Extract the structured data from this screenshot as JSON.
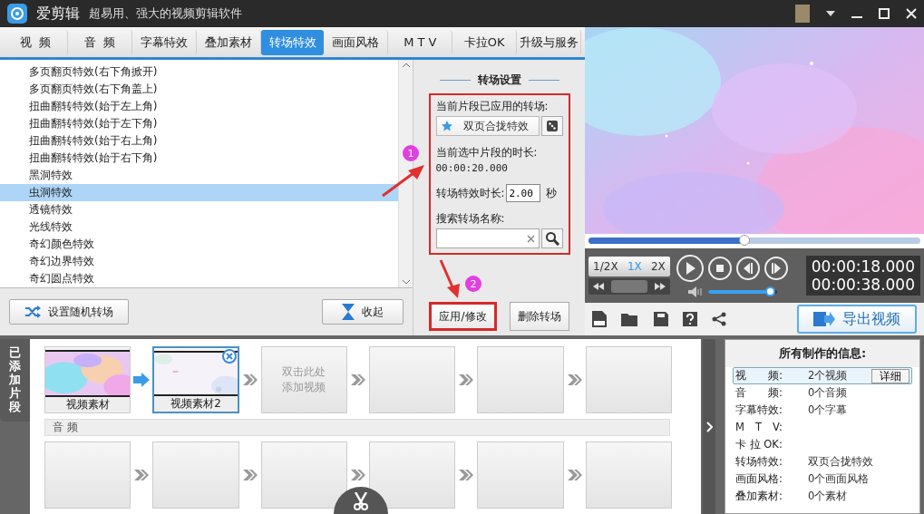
{
  "app": {
    "name": "爱剪辑",
    "slogan": "超易用、强大的视频剪辑软件"
  },
  "tabs": [
    {
      "label": "视  频",
      "selected": false
    },
    {
      "label": "音  频",
      "selected": false
    },
    {
      "label": "字幕特效",
      "selected": false
    },
    {
      "label": "叠加素材",
      "selected": false
    },
    {
      "label": "转场特效",
      "selected": true
    },
    {
      "label": "画面风格",
      "selected": false
    },
    {
      "label": "M T V",
      "selected": false
    },
    {
      "label": "卡拉OK",
      "selected": false
    },
    {
      "label": "升级与服务",
      "selected": false
    }
  ],
  "effects": [
    {
      "label": "多页翻页特效(右下角掀开)",
      "selected": false
    },
    {
      "label": "多页翻页特效(右下角盖上)",
      "selected": false
    },
    {
      "label": "扭曲翻转特效(始于左上角)",
      "selected": false
    },
    {
      "label": "扭曲翻转特效(始于左下角)",
      "selected": false
    },
    {
      "label": "扭曲翻转特效(始于右上角)",
      "selected": false
    },
    {
      "label": "扭曲翻转特效(始于右下角)",
      "selected": false
    },
    {
      "label": "黑洞特效",
      "selected": false
    },
    {
      "label": "虫洞特效",
      "selected": true
    },
    {
      "label": "透镜特效",
      "selected": false
    },
    {
      "label": "光线特效",
      "selected": false
    },
    {
      "label": "奇幻颜色特效",
      "selected": false
    },
    {
      "label": "奇幻边界特效",
      "selected": false
    },
    {
      "label": "奇幻圆点特效",
      "selected": false
    }
  ],
  "list_buttons": {
    "random": "设置随机转场",
    "collapse": "收起"
  },
  "settings": {
    "title": "转场设置",
    "highlighted": true,
    "applied_label": "当前片段已应用的转场:",
    "applied_value": "双页合拢特效",
    "duration_label": "当前选中片段的时长:",
    "duration_value": "00:00:20.000",
    "length_label": "转场特效时长:",
    "length_value": "2.00",
    "length_unit": "秒",
    "search_label": "搜索转场名称:"
  },
  "settings_buttons": [
    {
      "label": "应用/修改",
      "highlighted": true
    },
    {
      "label": "删除转场",
      "highlighted": false
    }
  ],
  "annotations": [
    {
      "label": "1"
    },
    {
      "label": "2"
    }
  ],
  "player": {
    "seek": {
      "level": 0.47
    },
    "speeds": [
      {
        "label": "1/2X",
        "selected": false
      },
      {
        "label": "1X",
        "selected": true
      },
      {
        "label": "2X",
        "selected": false
      }
    ],
    "volume": {
      "level": 0.9
    },
    "current_time": "00:00:18.000",
    "total_time": "00:00:38.000",
    "export": "导出视频"
  },
  "timeline": {
    "side_tab": "已添加片段",
    "clips": [
      {
        "kind": "clip",
        "label": "视频素材",
        "selected": false
      },
      {
        "kind": "clip",
        "label": "视频素材2",
        "selected": true
      },
      {
        "kind": "placeholder",
        "lines": [
          "双击此处",
          "添加视频"
        ]
      },
      {
        "kind": "empty"
      },
      {
        "kind": "empty"
      },
      {
        "kind": "empty"
      }
    ],
    "audio_label": "音 频"
  },
  "info": {
    "title": "所有制作的信息:",
    "rows": [
      {
        "label": "视　　频:",
        "value": "2个视频",
        "selected": true,
        "button": "详细"
      },
      {
        "label": "音　　频:",
        "value": "0个音频",
        "selected": false
      },
      {
        "label": "字幕特效:",
        "value": "0个字幕",
        "selected": false
      },
      {
        "label": "M　T　V:",
        "selected": false
      },
      {
        "label": "卡 拉 OK:",
        "selected": false
      },
      {
        "label": "转场特效:",
        "value": "双页合拢特效",
        "selected": false
      },
      {
        "label": "画面风格:",
        "value": "0个画面风格",
        "selected": false
      },
      {
        "label": "叠加素材:",
        "value": "0个素材",
        "selected": false
      }
    ]
  }
}
